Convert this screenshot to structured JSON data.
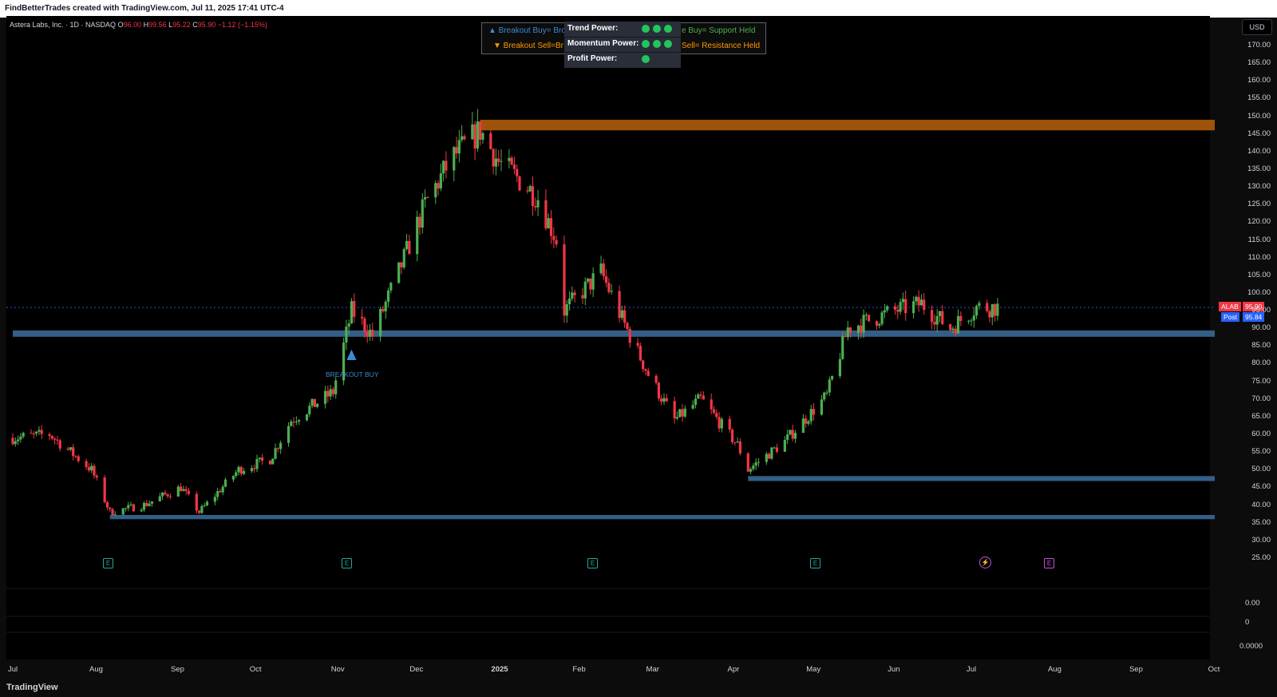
{
  "header": {
    "credit": "FindBetterTrades created with TradingView.com, Jul 11, 2025 17:41 UTC-4"
  },
  "symbol": {
    "name": "Astera Labs, Inc. · 1D · NASDAQ",
    "open_label": "O",
    "open": "96.00",
    "high_label": "H",
    "high": "99.56",
    "low_label": "L",
    "low": "95.22",
    "close_label": "C",
    "close": "95.90",
    "change": "−1.12 (−1.15%)"
  },
  "currency_button": "USD",
  "legend": {
    "row1_left": "▲ Breakout Buy= Brok",
    "row1_right": "e Buy= Support Held",
    "row2_left": "▼ Breakout Sell=Br",
    "row2_right": "Sell= Resistance Held"
  },
  "power_table": [
    {
      "label": "Trend Power:",
      "dots": 3
    },
    {
      "label": "Momentum Power:",
      "dots": 3
    },
    {
      "label": "Profit Power:",
      "dots": 1
    }
  ],
  "price_tags": {
    "last_symbol": "ALAB",
    "last_value": "95.90",
    "post_label": "Post",
    "post_value": "95.84"
  },
  "breakout_label": "BREAKOUT BUY",
  "event_badges": [
    "E",
    "E",
    "E",
    "E",
    "E"
  ],
  "lower_pane_values": [
    "0.00",
    "0",
    "0.0000"
  ],
  "footer": {
    "logo": "TradingView"
  },
  "colors": {
    "up": "#4caf50",
    "down": "#f23645",
    "resistance_zone": "#b8610a",
    "support_zone": "#3c6e9e",
    "breakout": "#3d8bd4",
    "last_price_tag": "#f23645",
    "post_price_tag": "#2962ff"
  },
  "chart_data": {
    "type": "candlestick",
    "y_ticks": [
      "170.00",
      "165.00",
      "160.00",
      "155.00",
      "150.00",
      "145.00",
      "140.00",
      "135.00",
      "130.00",
      "125.00",
      "120.00",
      "115.00",
      "110.00",
      "105.00",
      "100.00",
      "95.00",
      "90.00",
      "85.00",
      "80.00",
      "75.00",
      "70.00",
      "65.00",
      "60.00",
      "55.00",
      "50.00",
      "45.00",
      "40.00",
      "35.00",
      "30.00",
      "25.00"
    ],
    "ylim": [
      25,
      170
    ],
    "x_ticks": [
      "Jul",
      "Aug",
      "Sep",
      "Oct",
      "Nov",
      "Dec",
      "2025",
      "Feb",
      "Mar",
      "Apr",
      "May",
      "Jun",
      "Jul",
      "Aug",
      "Sep",
      "Oct"
    ],
    "close_path": [
      {
        "date": "2024-07-01",
        "close": 59
      },
      {
        "date": "2024-07-15",
        "close": 60
      },
      {
        "date": "2024-07-31",
        "close": 50
      },
      {
        "date": "2024-08-07",
        "close": 38
      },
      {
        "date": "2024-08-20",
        "close": 40
      },
      {
        "date": "2024-09-03",
        "close": 45
      },
      {
        "date": "2024-09-10",
        "close": 38
      },
      {
        "date": "2024-09-25",
        "close": 50
      },
      {
        "date": "2024-10-07",
        "close": 53
      },
      {
        "date": "2024-10-15",
        "close": 64
      },
      {
        "date": "2024-10-31",
        "close": 72
      },
      {
        "date": "2024-11-07",
        "close": 95
      },
      {
        "date": "2024-11-15",
        "close": 88
      },
      {
        "date": "2024-11-25",
        "close": 106
      },
      {
        "date": "2024-12-05",
        "close": 125
      },
      {
        "date": "2024-12-15",
        "close": 138
      },
      {
        "date": "2024-12-26",
        "close": 146
      },
      {
        "date": "2025-01-02",
        "close": 137
      },
      {
        "date": "2025-01-10",
        "close": 132
      },
      {
        "date": "2025-01-17",
        "close": 127
      },
      {
        "date": "2025-01-24",
        "close": 115
      },
      {
        "date": "2025-01-27",
        "close": 95
      },
      {
        "date": "2025-02-10",
        "close": 106
      },
      {
        "date": "2025-02-19",
        "close": 91
      },
      {
        "date": "2025-02-28",
        "close": 77
      },
      {
        "date": "2025-03-10",
        "close": 64
      },
      {
        "date": "2025-03-20",
        "close": 70
      },
      {
        "date": "2025-04-03",
        "close": 57
      },
      {
        "date": "2025-04-07",
        "close": 50
      },
      {
        "date": "2025-04-21",
        "close": 58
      },
      {
        "date": "2025-05-07",
        "close": 71
      },
      {
        "date": "2025-05-15",
        "close": 90
      },
      {
        "date": "2025-06-02",
        "close": 95
      },
      {
        "date": "2025-06-12",
        "close": 97
      },
      {
        "date": "2025-06-23",
        "close": 90
      },
      {
        "date": "2025-07-03",
        "close": 96
      },
      {
        "date": "2025-07-11",
        "close": 95.9
      }
    ],
    "zones": [
      {
        "name": "resistance",
        "low": 146,
        "high": 149,
        "from": "2024-12-26"
      },
      {
        "name": "support",
        "low": 87.6,
        "high": 89.4,
        "from": "2024-07-01"
      },
      {
        "name": "support",
        "low": 46.8,
        "high": 48.2,
        "from": "2025-04-07"
      },
      {
        "name": "support",
        "low": 36,
        "high": 37.2,
        "from": "2024-08-07"
      }
    ],
    "current_price": 95.9
  }
}
